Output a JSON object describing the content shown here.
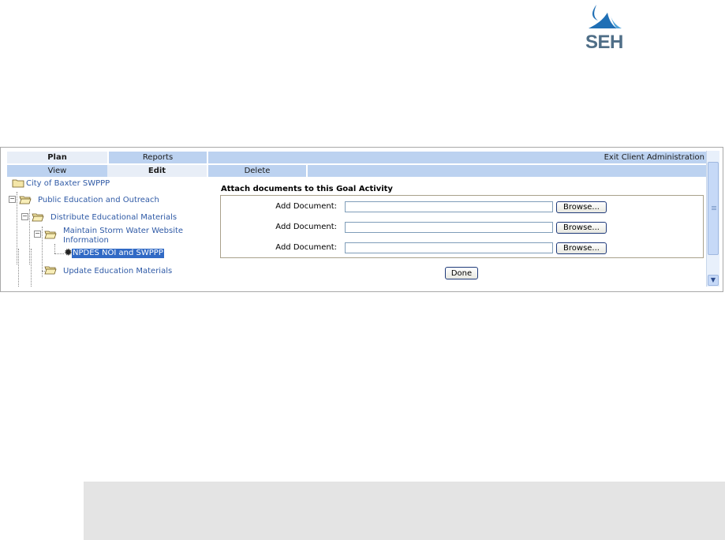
{
  "brand": {
    "logo_text": "SEH",
    "logo_color": "#4f6e87",
    "mark_colors": [
      "#1f6fb5",
      "#4fa3da"
    ]
  },
  "nav": {
    "top_tabs": [
      {
        "label": "Plan",
        "active": true
      },
      {
        "label": "Reports",
        "active": false
      }
    ],
    "exit_label": "Exit Client Administration",
    "sub_tabs": [
      {
        "label": "View",
        "active": false
      },
      {
        "label": "Edit",
        "active": true
      },
      {
        "label": "Delete",
        "active": false
      }
    ]
  },
  "tree": {
    "nodes": [
      {
        "label": "City of Baxter SWPPP",
        "icon": "folder-icon"
      },
      {
        "label": "Public Education and Outreach",
        "icon": "folder-open-icon",
        "expander": "minus"
      },
      {
        "label": "Distribute Educational Materials",
        "icon": "folder-open-icon",
        "expander": "minus"
      },
      {
        "label": "Maintain Storm Water Website Information",
        "icon": "folder-open-icon",
        "expander": "minus"
      },
      {
        "label": "NPDES NOI and SWPPP",
        "icon": "gear-icon",
        "selected": true
      },
      {
        "label": "Update Education Materials",
        "icon": "folder-open-icon"
      }
    ]
  },
  "attach": {
    "title": "Attach documents to this Goal Activity",
    "rows": [
      {
        "label": "Add Document:",
        "value": "",
        "button": "Browse..."
      },
      {
        "label": "Add Document:",
        "value": "",
        "button": "Browse..."
      },
      {
        "label": "Add Document:",
        "value": "",
        "button": "Browse..."
      }
    ],
    "done_label": "Done"
  },
  "colors": {
    "tab_bar": "#bcd2f0",
    "tab_active": "#e8eef7",
    "link": "#2f5aa6",
    "selection": "#316ac5"
  }
}
